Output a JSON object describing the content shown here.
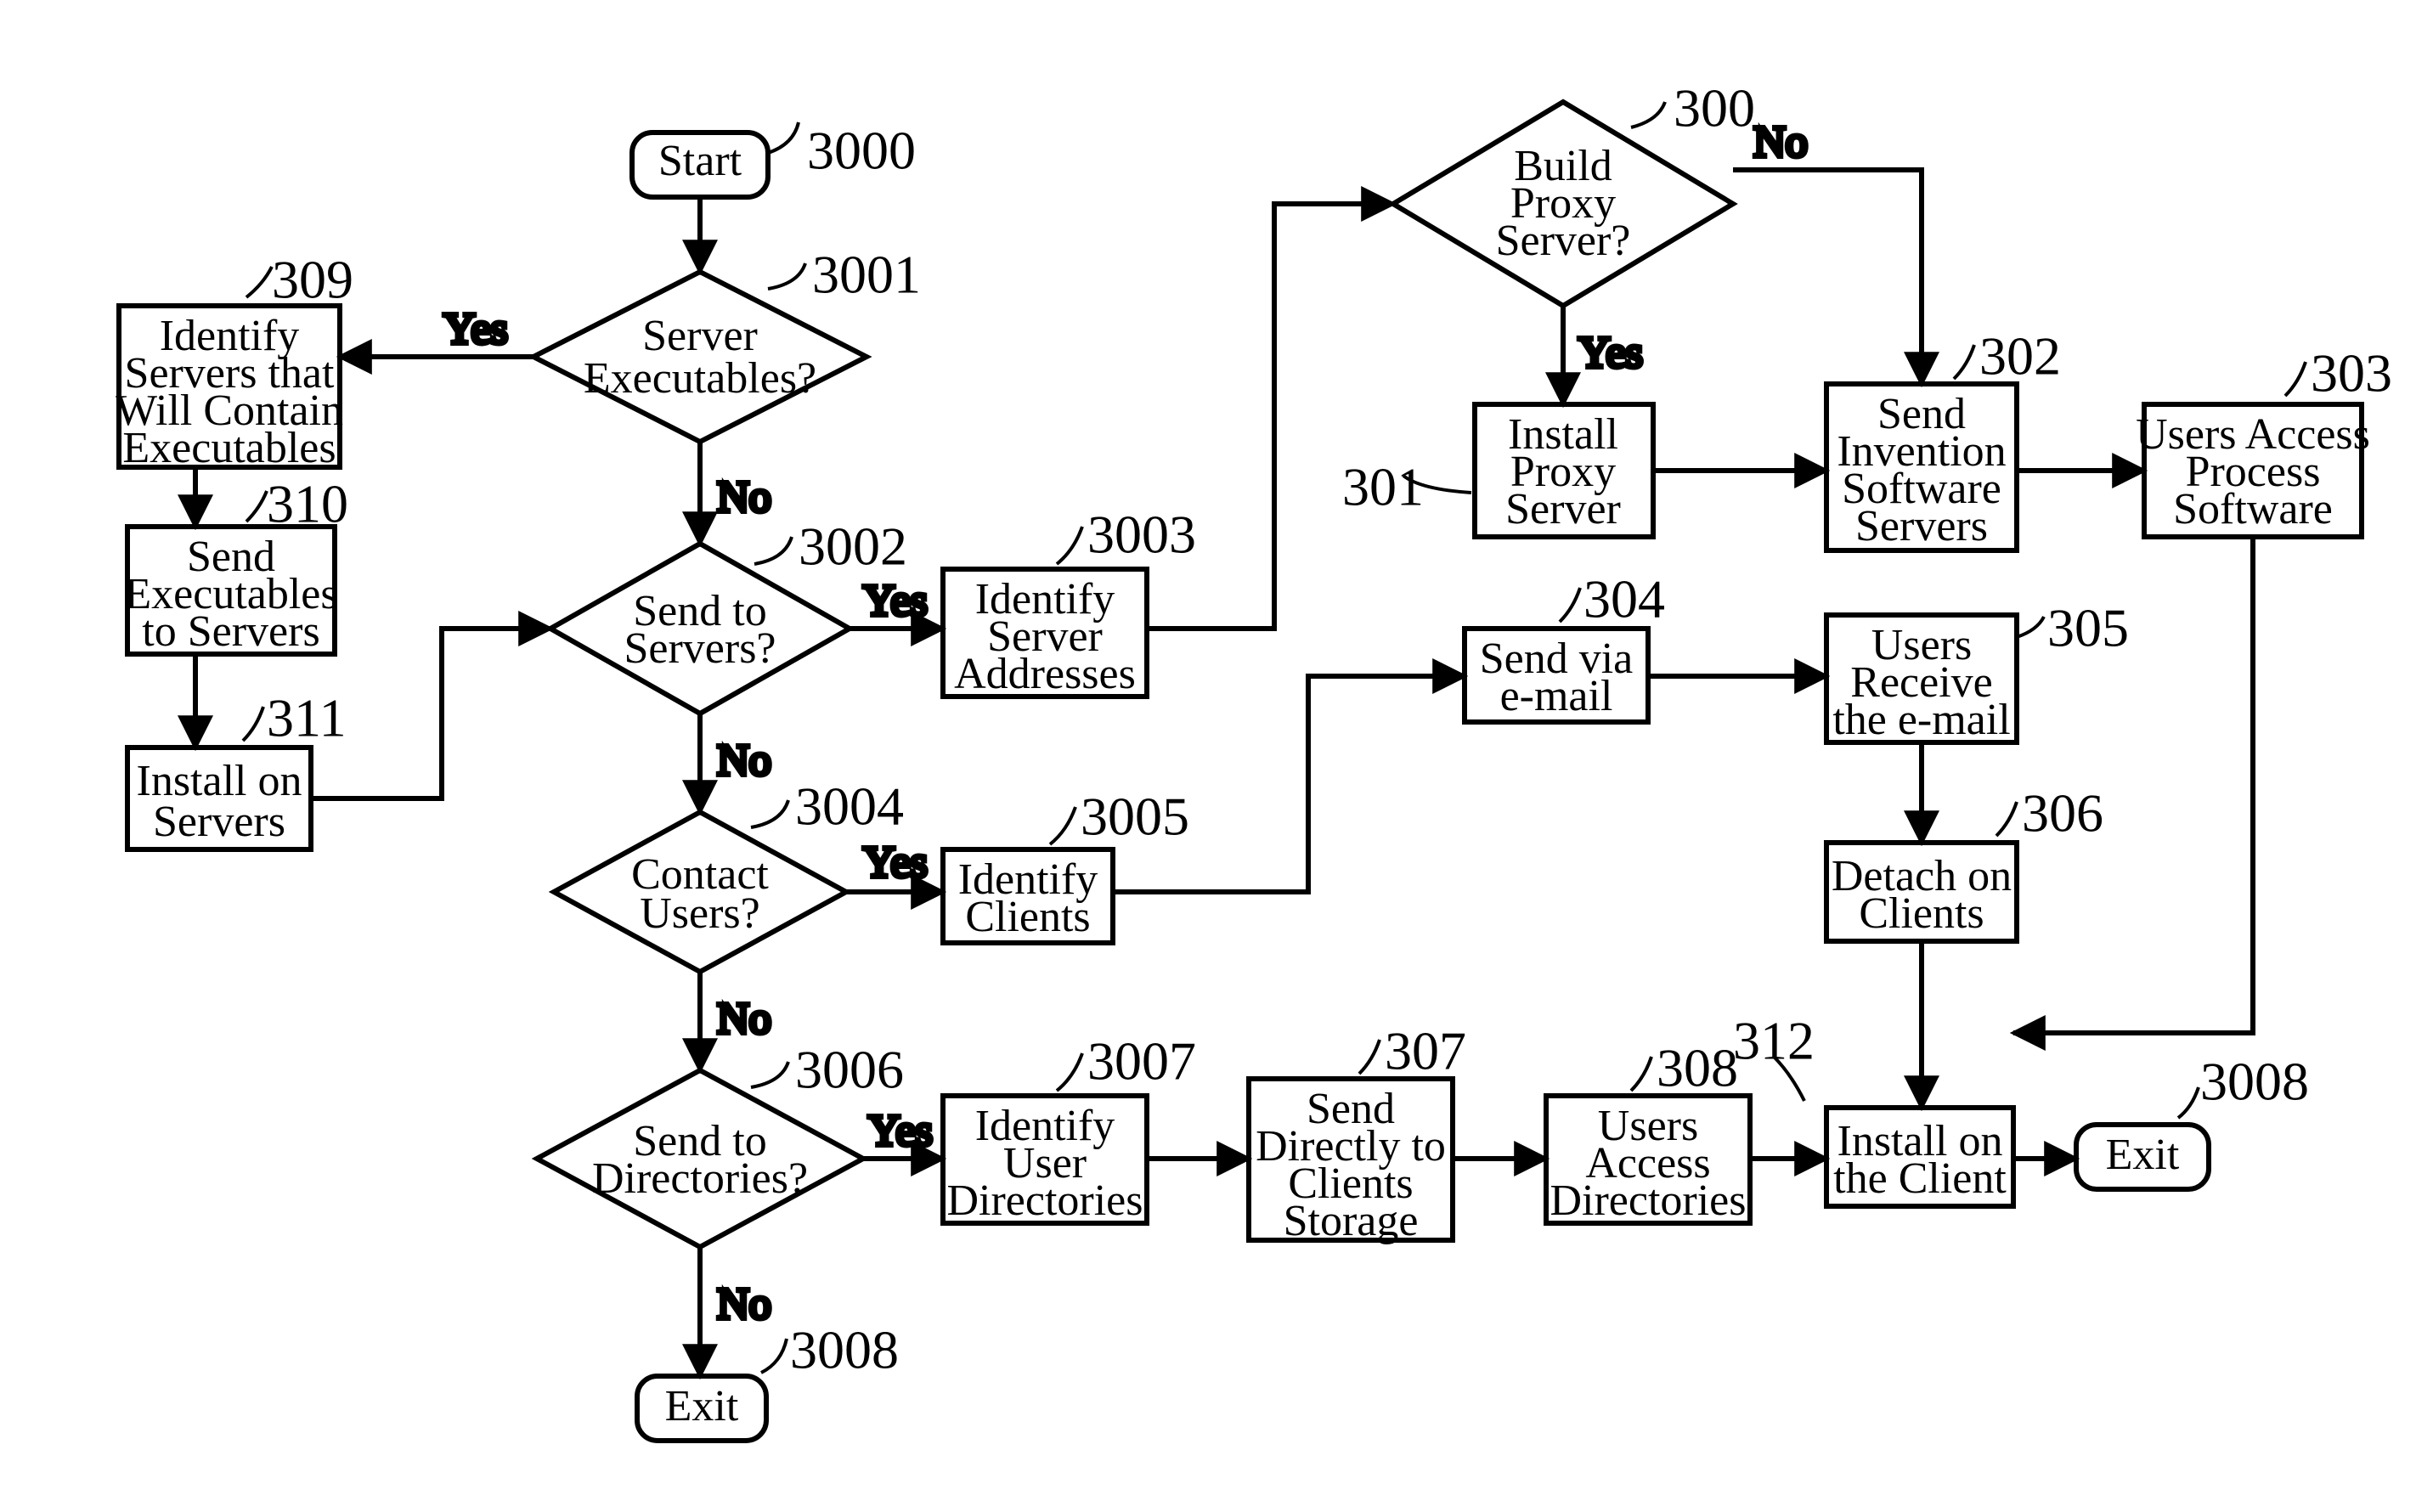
{
  "nodes": {
    "n3000": {
      "ref": "3000",
      "lines": [
        "Start"
      ]
    },
    "n3001": {
      "ref": "3001",
      "lines": [
        "Server",
        "Executables?"
      ]
    },
    "n309": {
      "ref": "309",
      "lines": [
        "Identify",
        "Servers that",
        "Will Contain",
        "Executables"
      ]
    },
    "n310": {
      "ref": "310",
      "lines": [
        "Send",
        "Executables",
        "to Servers"
      ]
    },
    "n311": {
      "ref": "311",
      "lines": [
        "Install on",
        "Servers"
      ]
    },
    "n3002": {
      "ref": "3002",
      "lines": [
        "Send to",
        "Servers?"
      ]
    },
    "n3003": {
      "ref": "3003",
      "lines": [
        "Identify",
        "Server",
        "Addresses"
      ]
    },
    "n3004": {
      "ref": "3004",
      "lines": [
        "Contact",
        "Users?"
      ]
    },
    "n3005": {
      "ref": "3005",
      "lines": [
        "Identify",
        "Clients"
      ]
    },
    "n3006": {
      "ref": "3006",
      "lines": [
        "Send to",
        "Directories?"
      ]
    },
    "n3007": {
      "ref": "3007",
      "lines": [
        "Identify",
        "User",
        "Directories"
      ]
    },
    "n307": {
      "ref": "307",
      "lines": [
        "Send",
        "Directly to",
        "Clients",
        "Storage"
      ]
    },
    "n308": {
      "ref": "308",
      "lines": [
        "Users",
        "Access",
        "Directories"
      ]
    },
    "n312": {
      "ref": "312",
      "lines": [
        "Install on",
        "the Client"
      ]
    },
    "n3008a": {
      "ref": "3008",
      "lines": [
        "Exit"
      ]
    },
    "n3008b": {
      "ref": "3008",
      "lines": [
        "Exit"
      ]
    },
    "n300": {
      "ref": "300",
      "lines": [
        "Build",
        "Proxy",
        "Server?"
      ]
    },
    "n301": {
      "ref": "301",
      "lines": [
        "Install",
        "Proxy",
        "Server"
      ]
    },
    "n302": {
      "ref": "302",
      "lines": [
        "Send",
        "Invention",
        "Software",
        "Servers"
      ]
    },
    "n303": {
      "ref": "303",
      "lines": [
        "Users Access",
        "Process",
        "Software"
      ]
    },
    "n304": {
      "ref": "304",
      "lines": [
        "Send via",
        "e-mail"
      ]
    },
    "n305": {
      "ref": "305",
      "lines": [
        "Users",
        "Receive",
        "the e-mail"
      ]
    },
    "n306": {
      "ref": "306",
      "lines": [
        "Detach on",
        "Clients"
      ]
    }
  },
  "labels": {
    "yes": "Yes",
    "no": "No"
  }
}
